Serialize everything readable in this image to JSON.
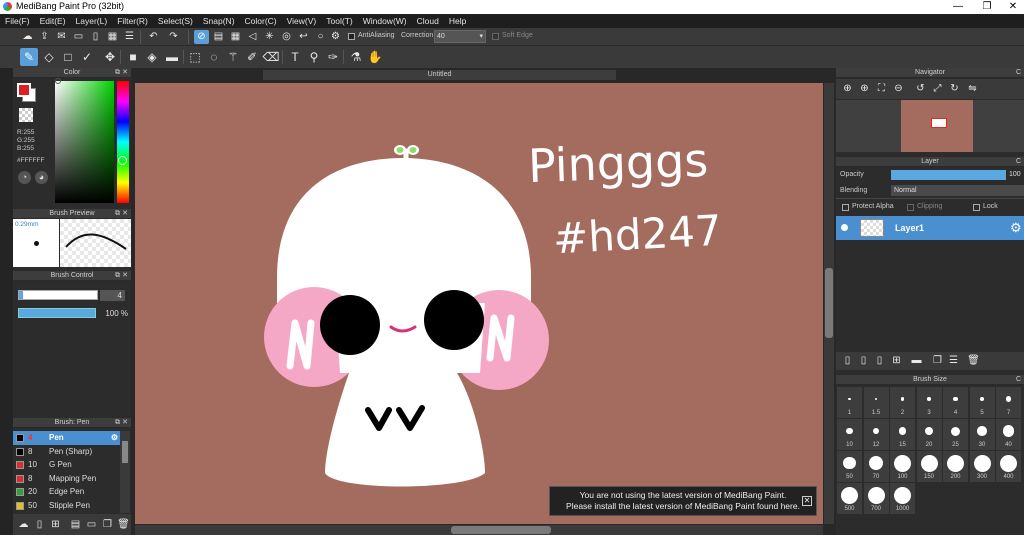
{
  "window": {
    "title": "MediBang Paint Pro (32bit)",
    "minimize": "—",
    "maximize": "❐",
    "close": "✕"
  },
  "menu": [
    "File(F)",
    "Edit(E)",
    "Layer(L)",
    "Filter(R)",
    "Select(S)",
    "Snap(N)",
    "Color(C)",
    "View(V)",
    "Tool(T)",
    "Window(W)",
    "Cloud",
    "Help"
  ],
  "toolbar": {
    "antialiasing_label": "AntiAliasing",
    "correction_label": "Correction",
    "correction_value": "40",
    "soft_edge_label": "Soft Edge"
  },
  "color_panel": {
    "title": "Color",
    "r": "R:255",
    "g": "G:255",
    "b": "B:255",
    "hex": "#FFFFFF",
    "primary_color": "#e02020",
    "secondary_color": "#ffffff"
  },
  "brush_preview": {
    "title": "Brush Preview",
    "size": "0.29mm"
  },
  "brush_control": {
    "title": "Brush Control",
    "size_value": "4",
    "opacity_value": "100 %"
  },
  "brush_list": {
    "title": "Brush: Pen",
    "items": [
      {
        "size": "4",
        "name": "Pen",
        "color": "#000000",
        "selected": true
      },
      {
        "size": "8",
        "name": "Pen (Sharp)",
        "color": "#000000",
        "selected": false
      },
      {
        "size": "10",
        "name": "G Pen",
        "color": "#d83030",
        "selected": false
      },
      {
        "size": "8",
        "name": "Mapping Pen",
        "color": "#d83030",
        "selected": false
      },
      {
        "size": "20",
        "name": "Edge Pen",
        "color": "#30a030",
        "selected": false
      },
      {
        "size": "50",
        "name": "Stipple Pen",
        "color": "#e0c020",
        "selected": false
      }
    ]
  },
  "canvas": {
    "tab_title": "Untitled",
    "background_color": "#a46b5f",
    "handwriting_line1": "Pingggs",
    "handwriting_line2": "#hd247"
  },
  "notice": {
    "line1": "You are not using the latest version of MediBang Paint.",
    "line2": "Please install the latest version of MediBang Paint found here."
  },
  "navigator": {
    "title": "Navigator"
  },
  "layer_panel": {
    "title": "Layer",
    "opacity_label": "Opacity",
    "opacity_value": "100",
    "blending_label": "Blending",
    "blending_value": "Normal",
    "protect_alpha": "Protect Alpha",
    "clipping": "Clipping",
    "lock": "Lock",
    "layer_name": "Layer1"
  },
  "brush_size": {
    "title": "Brush Size",
    "sizes": [
      "1",
      "1.5",
      "2",
      "3",
      "4",
      "5",
      "7",
      "10",
      "12",
      "15",
      "20",
      "25",
      "30",
      "40",
      "50",
      "70",
      "100",
      "150",
      "200",
      "300",
      "400",
      "500",
      "700",
      "1000"
    ]
  }
}
